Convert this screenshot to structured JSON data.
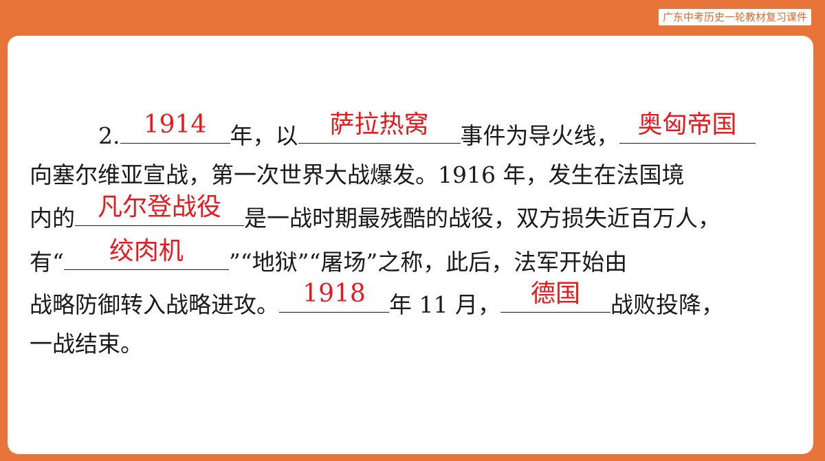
{
  "header": {
    "badge": "广东中考历史一轮教材复习课件"
  },
  "question": {
    "number": "2.",
    "answers": {
      "a1": "1914",
      "a2": "萨拉热窝",
      "a3": "奥匈帝国",
      "a4": "凡尔登战役",
      "a5": "绞肉机",
      "a6": "1918",
      "a7": "德国"
    },
    "text": {
      "t1": "年，以",
      "t2": "事件为导火线，",
      "t3": "向塞尔维亚宣战，第一次世界大战爆发。1916 年，发生在法国境",
      "t4": "内的",
      "t5": "是一战时期最残酷的战役，双方损失近百万人，",
      "t6": "有“",
      "t7": "”“地狱”“屠场”之称，此后，法军开始由",
      "t8": "战略防御转入战略进攻。",
      "t9": "年 11 月，",
      "t10": "战败投降，",
      "t11": "一战结束。"
    }
  }
}
